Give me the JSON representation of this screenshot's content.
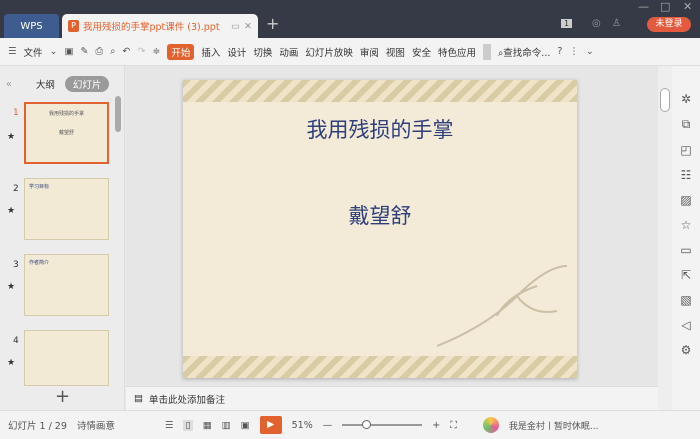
{
  "titlebar": {
    "wps_label": "WPS",
    "doc_title": "我用残损的手掌ppt课件 (3).ppt",
    "new_tab": "+",
    "badge": "1",
    "login": "未登录"
  },
  "toolbar": {
    "file": "文件",
    "tabs": [
      "开始",
      "插入",
      "设计",
      "切换",
      "动画",
      "幻灯片放映",
      "审阅",
      "视图",
      "安全",
      "特色应用"
    ],
    "search": "查找命令...",
    "help": "?"
  },
  "panel": {
    "outline_tab": "大纲",
    "slides_tab": "幻灯片",
    "add": "+"
  },
  "thumbs": [
    {
      "num": "1",
      "title": "我用残损的手掌",
      "sub": "戴望舒"
    },
    {
      "num": "2",
      "title": "学习目标",
      "sub": ""
    },
    {
      "num": "3",
      "title": "作者简介",
      "sub": ""
    },
    {
      "num": "4",
      "title": "",
      "sub": ""
    }
  ],
  "slide": {
    "title": "我用残损的手掌",
    "subtitle": "戴望舒"
  },
  "notes": {
    "placeholder": "单击此处添加备注"
  },
  "status": {
    "slide_counter": "幻灯片 1 / 29",
    "theme": "诗情画意",
    "zoom": "51%",
    "user": "我是金村丨暂时休眠..."
  },
  "colors": {
    "accent": "#e2622f",
    "titlebar": "#353a46",
    "slide_text": "#2e3f7a"
  }
}
